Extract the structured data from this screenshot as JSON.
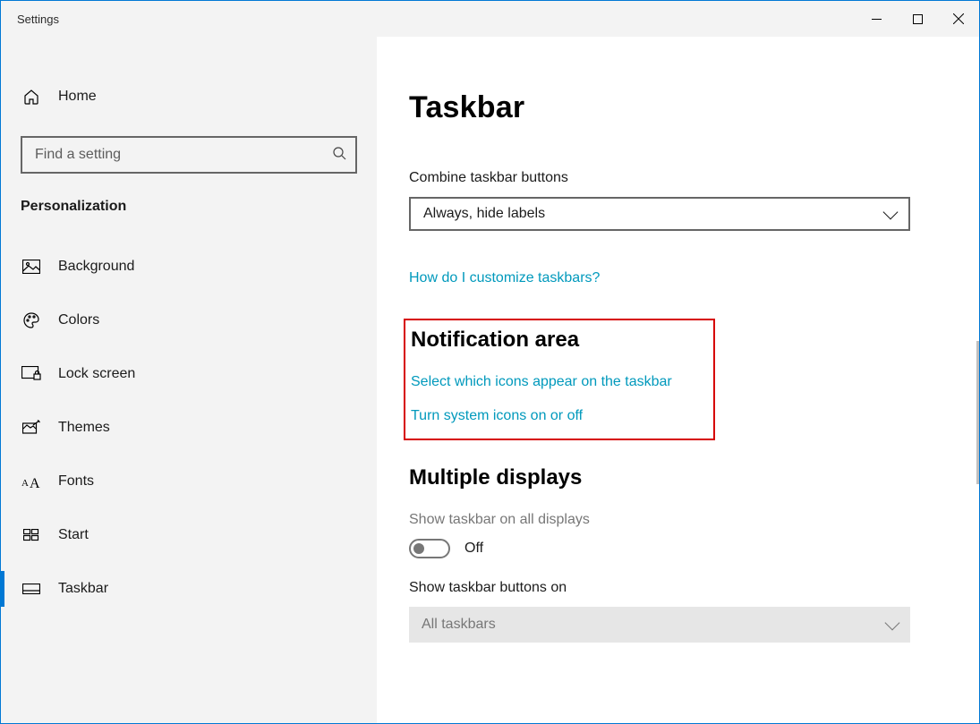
{
  "window": {
    "title": "Settings"
  },
  "sidebar": {
    "home_label": "Home",
    "search_placeholder": "Find a setting",
    "section_label": "Personalization",
    "items": [
      {
        "label": "Background"
      },
      {
        "label": "Colors"
      },
      {
        "label": "Lock screen"
      },
      {
        "label": "Themes"
      },
      {
        "label": "Fonts"
      },
      {
        "label": "Start"
      },
      {
        "label": "Taskbar"
      }
    ]
  },
  "main": {
    "heading": "Taskbar",
    "combine_label": "Combine taskbar buttons",
    "combine_value": "Always, hide labels",
    "help_link": "How do I customize taskbars?",
    "notification_heading": "Notification area",
    "notif_link1": "Select which icons appear on the taskbar",
    "notif_link2": "Turn system icons on or off",
    "multi_heading": "Multiple displays",
    "show_all_label": "Show taskbar on all displays",
    "show_all_state": "Off",
    "show_buttons_label": "Show taskbar buttons on",
    "show_buttons_value": "All taskbars"
  }
}
